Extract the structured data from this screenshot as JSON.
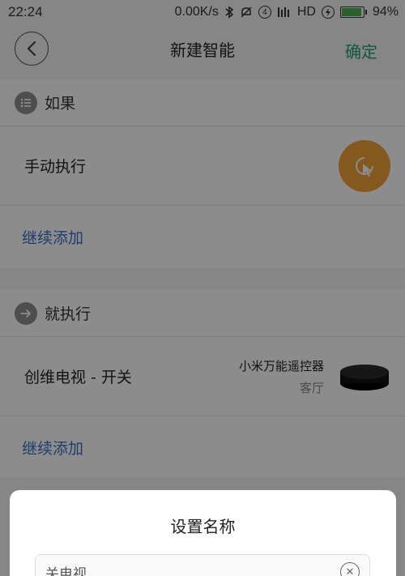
{
  "status_bar": {
    "time": "22:24",
    "net_speed": "0.00K/s",
    "sim_badge": "4",
    "network": "HD",
    "battery_percent": "94%",
    "battery_level": 0.94
  },
  "header": {
    "title": "新建智能",
    "confirm_label": "确定"
  },
  "if_section": {
    "title": "如果",
    "row_label": "手动执行",
    "add_label": "继续添加"
  },
  "then_section": {
    "title": "就执行",
    "row_label": "创维电视 - 开关",
    "device_name": "小米万能遥控器",
    "device_room": "客厅",
    "add_label": "继续添加"
  },
  "dialog": {
    "title": "设置名称",
    "input_value": "关电视"
  },
  "colors": {
    "accent_green": "#1f9e7a",
    "link_blue": "#3a6fc9",
    "manual_orange": "#f0a03a"
  }
}
